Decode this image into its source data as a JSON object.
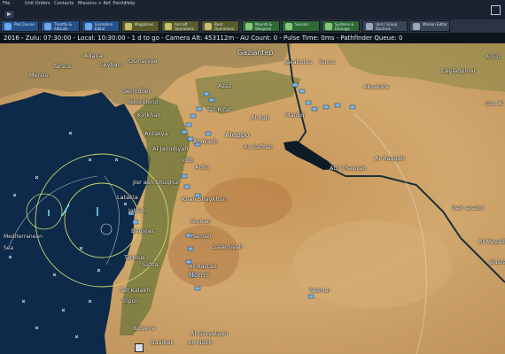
{
  "menu": {
    "items": [
      "File",
      "Unit Orders",
      "Contacts",
      "Missions + Ref. Points",
      "Help"
    ]
  },
  "toolbar": {
    "buttons": [
      {
        "label": "Plot Course",
        "color": "#25508a"
      },
      {
        "label": "Throttle & Altitude",
        "color": "#25508a"
      },
      {
        "label": "Formation Editor",
        "color": "#25508a"
      },
      {
        "label": "Magazines",
        "color": "#5a5b2a"
      },
      {
        "label": "Aircraft Operations",
        "color": "#5a5b2a"
      },
      {
        "label": "Boat Operations",
        "color": "#5a5b2a"
      },
      {
        "label": "Mounts & Weapons",
        "color": "#2f6a34"
      },
      {
        "label": "Sensors",
        "color": "#2f6a34"
      },
      {
        "label": "Systems & Damage",
        "color": "#2f6a34"
      },
      {
        "label": "Unit / Group Doctrine",
        "color": "#3a4556"
      },
      {
        "label": "Mission Editor",
        "color": "#3a4556"
      }
    ]
  },
  "status": {
    "text": "2016 - Zulu: 07:30:00 - Local: 10:30:00 - 1 d to go - Camera Alt: 453112m - AU Count: 0 - Pulse Time: 0ms - Pathfinder Queue: 0"
  },
  "map": {
    "places": [
      "Gaziantep",
      "Jarabulus",
      "Suruc",
      "Akcakale",
      "Ceylanpinar",
      "Adana",
      "Ceyhan",
      "Osmaniye",
      "Tarsus",
      "Mersin",
      "Derindiler",
      "Iskenderun",
      "Kirikhan",
      "Antakya",
      "Azaz",
      "Tall Rifat",
      "Al Bab",
      "Manbij",
      "Aleppo",
      "As Safirah",
      "Al Atarib",
      "Idlib",
      "Ariha",
      "Al Janudiyah",
      "Ar Raqqah",
      "Ath Thawrah",
      "Jisr ash Shughur",
      "Latakia",
      "Jablah",
      "Baniyas",
      "Tartous",
      "Safita",
      "Khan Shaykhun",
      "Souran",
      "Hamah",
      "Salamiyah",
      "Ar Rastan",
      "Homs",
      "Tall Kalakh",
      "Tripoli",
      "Tadmur",
      "Al Qaryatayn",
      "An Nabk",
      "Baalbek",
      "Bcharre",
      "Deir ez-Zor",
      "Al Mayadin",
      "Busra",
      "Dar Ai"
    ],
    "sea_labels": [
      "Mediterranean",
      "Sea",
      "Al Fat"
    ],
    "colors": {
      "sea": "#0d2a4a",
      "land": "#c9a267",
      "green": "#6b7538",
      "rings": "#cfd86a"
    }
  }
}
